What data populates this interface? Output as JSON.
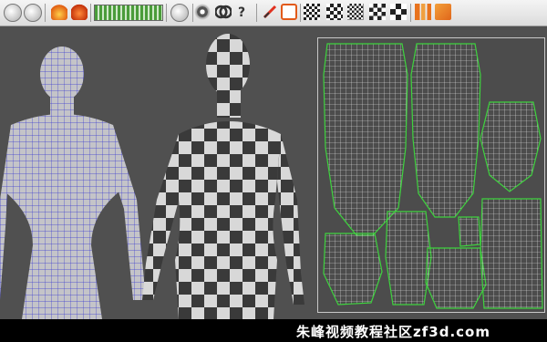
{
  "toolbar": {
    "icons": [
      "prev-arrow-icon",
      "next-arrow-icon",
      "flame-icon",
      "fire-icon",
      "progress-bar",
      "speaker-icon",
      "camera-icon",
      "link-icon",
      "help-icon",
      "brush-paint-icon",
      "stop-icon",
      "checker-small-icon",
      "checker-q-icon",
      "checker-medium-icon",
      "checker-large-icon",
      "checker-xl-icon",
      "bars-icon",
      "tag-icon"
    ]
  },
  "viewport": {
    "figures": [
      "wireframe-female-front",
      "checker-textured-female-back"
    ],
    "panel": "uv-layout-panel"
  },
  "watermark": {
    "text": "朱峰视频教程社区zf3d.com"
  }
}
